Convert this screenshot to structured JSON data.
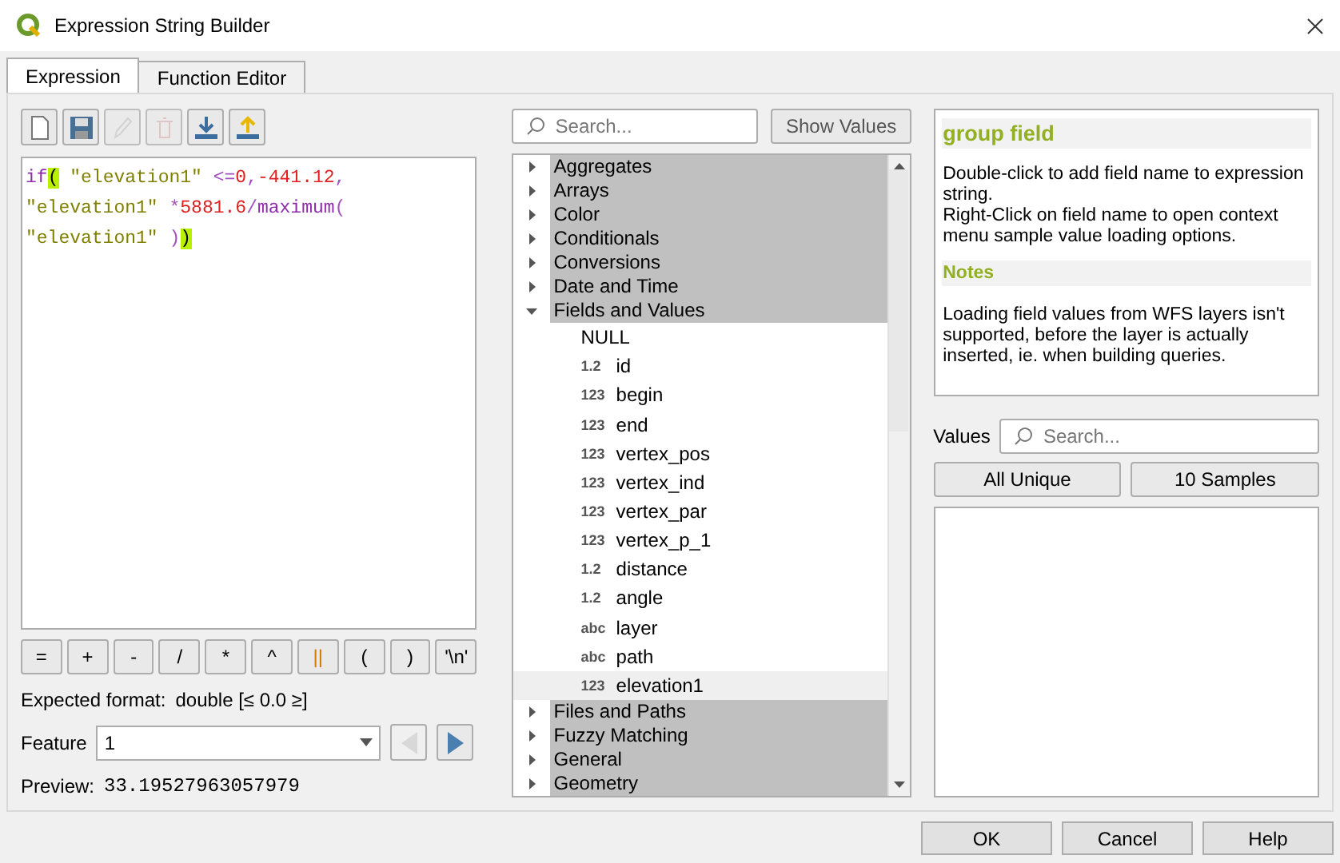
{
  "window": {
    "title": "Expression String Builder"
  },
  "tabs": [
    {
      "label": "Expression",
      "selected": true
    },
    {
      "label": "Function Editor",
      "selected": false
    }
  ],
  "toolbar": [
    {
      "kind": "new",
      "disabled": false
    },
    {
      "kind": "save",
      "disabled": false
    },
    {
      "kind": "edit",
      "disabled": true
    },
    {
      "kind": "delete",
      "disabled": true
    },
    {
      "kind": "import",
      "disabled": false
    },
    {
      "kind": "export",
      "disabled": false
    }
  ],
  "expression": {
    "lines": [
      [
        {
          "kind": "function",
          "text": "if"
        },
        {
          "kind": "bracket",
          "text": "("
        },
        {
          "kind": "field",
          "text": " \"elevation1\""
        },
        {
          "kind": "operator",
          "text": " <="
        },
        {
          "kind": "number",
          "text": "0"
        },
        {
          "kind": "operator",
          "text": ","
        },
        {
          "kind": "number",
          "text": "-441.12"
        },
        {
          "kind": "operator",
          "text": ","
        }
      ],
      [
        {
          "kind": "field",
          "text": "\"elevation1\""
        },
        {
          "kind": "operator",
          "text": " *"
        },
        {
          "kind": "number",
          "text": "5881.6"
        },
        {
          "kind": "operator",
          "text": "/"
        },
        {
          "kind": "function",
          "text": "maximum"
        },
        {
          "kind": "operator",
          "text": "("
        }
      ],
      [
        {
          "kind": "field",
          "text": "\"elevation1\""
        },
        {
          "kind": "operator",
          "text": " )"
        },
        {
          "kind": "bracket",
          "text": ")"
        }
      ]
    ]
  },
  "operators": [
    {
      "label": "=",
      "kind": "math"
    },
    {
      "label": "+",
      "kind": "math"
    },
    {
      "label": "-",
      "kind": "math"
    },
    {
      "label": "/",
      "kind": "math"
    },
    {
      "label": "*",
      "kind": "math"
    },
    {
      "label": "^",
      "kind": "math"
    },
    {
      "label": "||",
      "kind": "concat"
    },
    {
      "label": "(",
      "kind": "math"
    },
    {
      "label": ")",
      "kind": "math"
    },
    {
      "label": "'\\n'",
      "kind": "math"
    }
  ],
  "expected_format": {
    "label": "Expected format:",
    "value": "double [≤ 0.0 ≥]"
  },
  "feature": {
    "label": "Feature",
    "value": "1",
    "previous_disabled": true,
    "next_disabled": false
  },
  "preview": {
    "label": "Preview:",
    "value": "33.19527963057979"
  },
  "search": {
    "placeholder": "Search..."
  },
  "show_values_button": "Show Values",
  "tree": [
    {
      "label": "Aggregates",
      "expanded": false
    },
    {
      "label": "Arrays",
      "expanded": false
    },
    {
      "label": "Color",
      "expanded": false
    },
    {
      "label": "Conditionals",
      "expanded": false
    },
    {
      "label": "Conversions",
      "expanded": false
    },
    {
      "label": "Date and Time",
      "expanded": false
    },
    {
      "label": "Fields and Values",
      "expanded": true,
      "children": [
        {
          "label": "NULL",
          "selected": false
        },
        {
          "badge": "1.2",
          "label": "id",
          "selected": false
        },
        {
          "badge": "123",
          "label": "begin",
          "selected": false
        },
        {
          "badge": "123",
          "label": "end",
          "selected": false
        },
        {
          "badge": "123",
          "label": "vertex_pos",
          "selected": false
        },
        {
          "badge": "123",
          "label": "vertex_ind",
          "selected": false
        },
        {
          "badge": "123",
          "label": "vertex_par",
          "selected": false
        },
        {
          "badge": "123",
          "label": "vertex_p_1",
          "selected": false
        },
        {
          "badge": "1.2",
          "label": "distance",
          "selected": false
        },
        {
          "badge": "1.2",
          "label": "angle",
          "selected": false
        },
        {
          "badge": "abc",
          "label": "layer",
          "selected": false
        },
        {
          "badge": "abc",
          "label": "path",
          "selected": false
        },
        {
          "badge": "123",
          "label": "elevation1",
          "selected": true
        }
      ]
    },
    {
      "label": "Files and Paths",
      "expanded": false
    },
    {
      "label": "Fuzzy Matching",
      "expanded": false
    },
    {
      "label": "General",
      "expanded": false
    },
    {
      "label": "Geometry",
      "expanded": false
    }
  ],
  "help": {
    "title": "group field",
    "body": [
      "Double-click to add field name to expression string.",
      "Right-Click on field name to open context menu sample value loading options."
    ],
    "notes_title": "Notes",
    "notes": "Loading field values from WFS layers isn't supported, before the layer is actually inserted, ie. when building queries."
  },
  "values": {
    "label": "Values",
    "search_placeholder": "Search...",
    "buttons": [
      "All Unique",
      "10 Samples"
    ]
  },
  "dialog_buttons": [
    "OK",
    "Cancel",
    "Help"
  ]
}
